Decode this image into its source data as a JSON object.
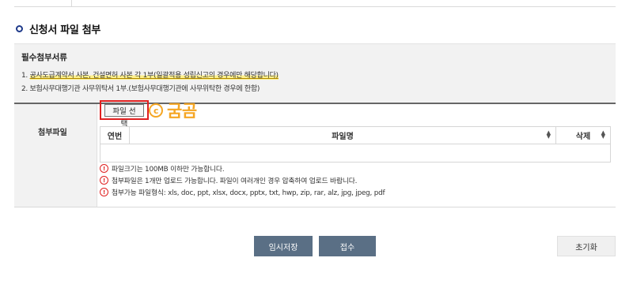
{
  "section": {
    "title": "신청서 파일 첨부"
  },
  "info": {
    "heading": "필수첨부서류",
    "line1_prefix": "1. ",
    "line1_highlight": "공사도급계약서 사본, 건설면허 사본 각 1부(일괄적용 성립신고의 경우에만 해당합니다)",
    "line2": "2. 보험사무대행기관 사무위탁서 1부.(보험사무대행기관에 사무위탁한 경우에 한함)"
  },
  "form": {
    "label": "첨부파일",
    "file_button": "파일 선택",
    "watermark": "굼곰",
    "table_headers": {
      "no": "연번",
      "name": "파일명",
      "delete": "삭제"
    },
    "notes": [
      "파일크기는 100MB 이하만 가능합니다.",
      "첨부파일은 1개만 업로드 가능합니다. 파일이 여러개인 경우 압축하여 업로드 바랍니다.",
      "첨부가능 파일형식: xls, doc, ppt, xlsx, docx, pptx, txt, hwp, zip, rar, alz, jpg, jpeg, pdf"
    ]
  },
  "buttons": {
    "temp_save": "임시저장",
    "submit": "접수",
    "reset": "초기화"
  },
  "colors": {
    "accent_red": "#e02020",
    "button_dark": "#5a6f85",
    "watermark": "#f5a623",
    "highlight": "#fff08a"
  }
}
